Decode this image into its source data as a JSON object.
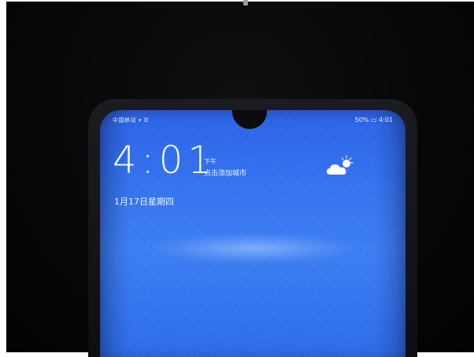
{
  "status_bar": {
    "left_text": "中国移动 ▾ ☰",
    "right_text": "50% ▭ 4:01"
  },
  "lock_screen": {
    "time": "4:01",
    "ampm": "下午",
    "city_prompt": "点击添加城市",
    "date": "1月17日星期四"
  },
  "icons": {
    "weather": "partly-cloudy-icon"
  },
  "colors": {
    "screen_blue": "#3573ef",
    "background": "#050505"
  }
}
